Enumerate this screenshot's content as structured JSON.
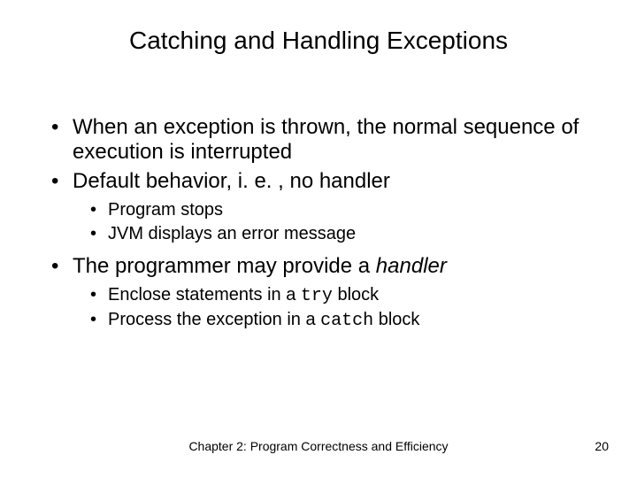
{
  "title": "Catching and Handling Exceptions",
  "bullets": {
    "b1": "When an exception is thrown, the normal sequence of execution is interrupted",
    "b2": "Default behavior, i. e. , no handler",
    "b2_sub1": "Program stops",
    "b2_sub2": "JVM displays an error message",
    "b3_pre": "The programmer may provide a ",
    "b3_em": "handler",
    "b3_sub1_pre": "Enclose statements in a ",
    "b3_sub1_code": "try",
    "b3_sub1_post": " block",
    "b3_sub2_pre": "Process the exception in a ",
    "b3_sub2_code": "catch",
    "b3_sub2_post": " block"
  },
  "footer": {
    "center": "Chapter 2: Program Correctness and Efficiency",
    "page": "20"
  }
}
